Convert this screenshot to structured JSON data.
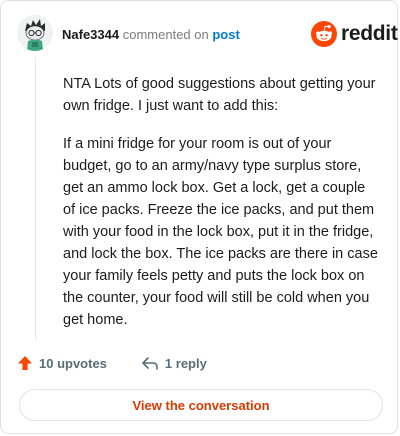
{
  "comment": {
    "username": "Nafe3344",
    "commented_on": "commented on",
    "post_link": "post",
    "paragraphs": [
      "NTA Lots of good suggestions about getting your own fridge. I just want to add this:",
      "If a mini fridge for your room is out of your budget, go to an army/navy type surplus store, get an ammo lock box. Get a lock, get a couple of ice packs. Freeze the ice packs, and put them with your food in the lock box, put it in the fridge, and lock the box. The ice packs are there in case your family feels petty and puts the lock box on the counter, your food will still be cold when you get home."
    ]
  },
  "brand": {
    "logo_text": "reddit",
    "logo_icon": "reddit-snoo-icon",
    "accent": "#ff4500"
  },
  "actions": {
    "upvotes": "10 upvotes",
    "upvote_icon": "upvote-arrow-icon",
    "replies": "1 reply",
    "reply_icon": "reply-arrow-icon"
  },
  "cta": {
    "label": "View the conversation",
    "color": "#d93a00"
  },
  "colors": {
    "link": "#0079d3",
    "muted": "#7c7c7c",
    "border": "#dfe1e3"
  }
}
